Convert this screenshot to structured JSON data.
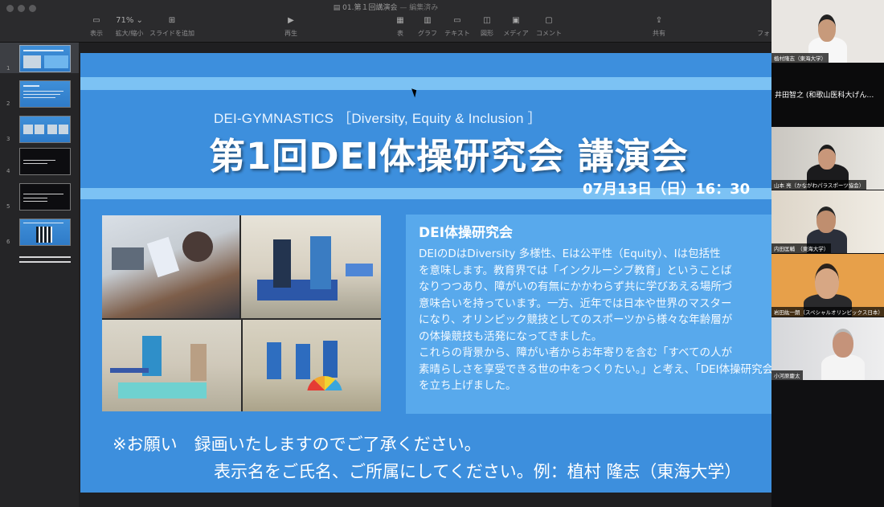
{
  "window": {
    "document_title": "01.第１回講演会",
    "document_status": "— 編集済み"
  },
  "toolbar": {
    "items": [
      {
        "label": "表示",
        "icon": "sidebar-icon"
      },
      {
        "label": "拡大/縮小",
        "value": "71%",
        "icon": "zoom-icon"
      },
      {
        "label": "スライドを追加",
        "icon": "add-slide-icon"
      },
      {
        "label": "再生",
        "icon": "play-icon"
      },
      {
        "label": "表",
        "icon": "table-icon"
      },
      {
        "label": "グラフ",
        "icon": "chart-icon"
      },
      {
        "label": "テキスト",
        "icon": "text-icon"
      },
      {
        "label": "図形",
        "icon": "shape-icon"
      },
      {
        "label": "メディア",
        "icon": "media-icon"
      },
      {
        "label": "コメント",
        "icon": "comment-icon"
      },
      {
        "label": "共有",
        "icon": "share-icon"
      },
      {
        "label": "フォ",
        "icon": "format-icon"
      }
    ]
  },
  "navigator": {
    "slides": [
      {
        "number": "1",
        "selected": true
      },
      {
        "number": "2",
        "selected": false
      },
      {
        "number": "3",
        "selected": false
      },
      {
        "number": "4",
        "selected": false
      },
      {
        "number": "5",
        "selected": false
      },
      {
        "number": "6",
        "selected": false
      }
    ]
  },
  "slide": {
    "subtitle": "DEI-GYMNASTICS ［Diversity, Equity & Inclusion ］",
    "title": "第1回DEI体操研究会 講演会",
    "date": "07月13日（日）16：30",
    "panel": {
      "heading": "DEI体操研究会",
      "body_lines": [
        "DEIのDはDiversity 多様性、Eは公平性（Equity）、Iは包括性",
        "を意味します。教育界では「インクルーシブ教育」ということば",
        "なりつつあり、障がいの有無にかかわらず共に学びあえる場所づ",
        "意味合いを持っています。一方、近年では日本や世界のマスター",
        "になり、オリンピック競技としてのスポーツから様々な年齢層が",
        "の体操競技も活発になってきました。",
        "これらの背景から、障がい者からお年寄りを含む「すべての人が",
        "素晴らしさを享受できる世の中をつくりたい。」と考え、「DEI体操研究会",
        "を立ち上げました。"
      ]
    },
    "notice": {
      "line1": "※お願い　録画いたしますのでご了承ください。",
      "line2": "表示名をご氏名、ご所属にしてください。例：植村 隆志（東海大学）"
    },
    "colors": {
      "background": "#3d8fdd",
      "band": "#7cc2f4",
      "panel": "#58a9ec"
    }
  },
  "participants": [
    {
      "name": "植村隆志（東海大学）",
      "video": true
    },
    {
      "name": "井田智之 (和歌山医科大げん…",
      "video": false
    },
    {
      "name": "山本 亮（かながわパラスポーツ協会）",
      "video": true
    },
    {
      "name": "内田匡輔　（東海大学）",
      "video": true
    },
    {
      "name": "岩田紘一朗（スペシャルオリンピックス日本）",
      "video": true
    },
    {
      "name": "小河原慶太",
      "video": true
    }
  ]
}
